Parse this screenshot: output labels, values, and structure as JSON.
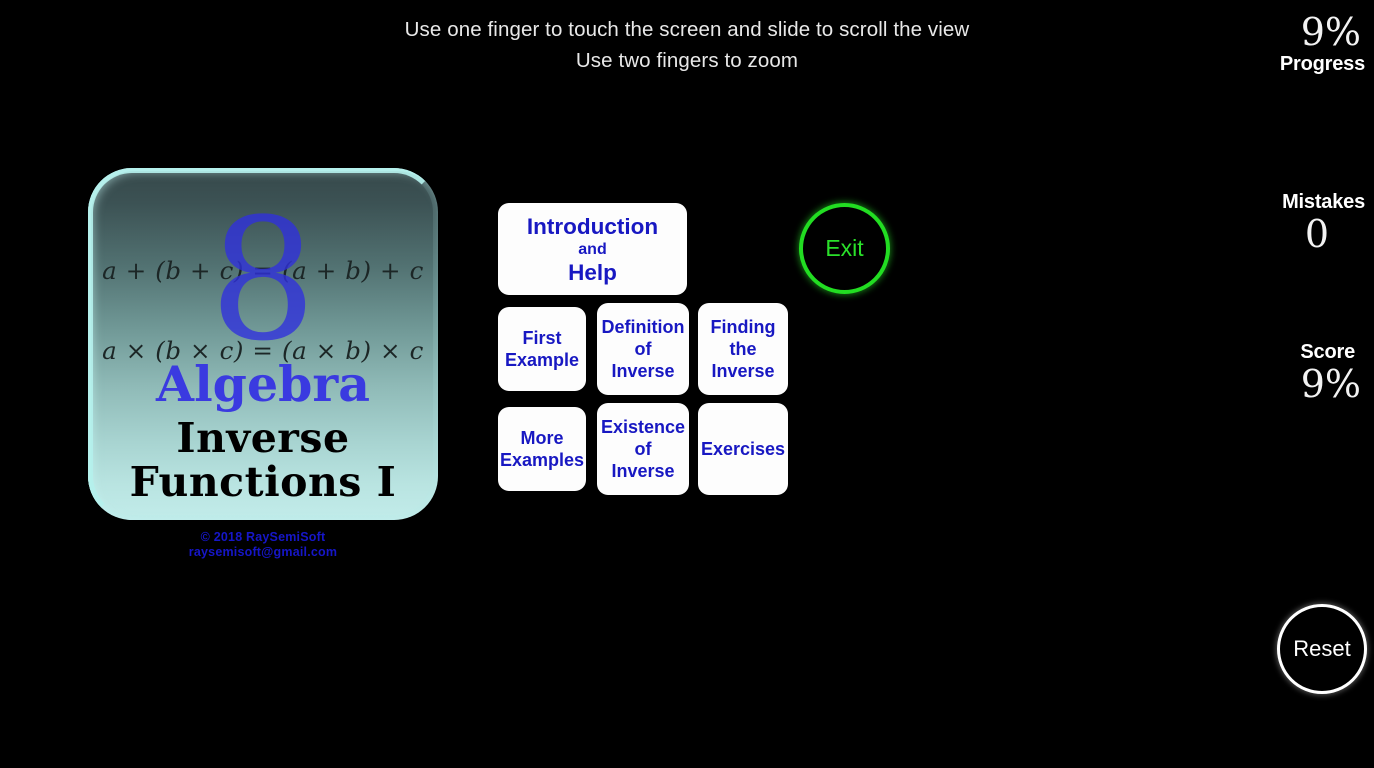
{
  "instructions": {
    "line1": "Use one finger to touch the screen and slide to scroll the view",
    "line2": "Use two fingers to zoom"
  },
  "stats": {
    "progress": {
      "label": "Progress",
      "value": "9%"
    },
    "mistakes": {
      "label": "Mistakes",
      "value": "0"
    },
    "score": {
      "label": "Score",
      "value": "9%"
    }
  },
  "title_card": {
    "badge_number": "8",
    "formula1": "a + (b + c) = (a + b) + c",
    "formula2": "a × (b × c) = (a × b) × c",
    "subject": "Algebra",
    "topic_line1": "Inverse",
    "topic_line2": "Functions I",
    "subject_color": "#3a3ae0",
    "badge_color": "#3030de",
    "border_color": "#b5f0ec"
  },
  "copyright": {
    "line1": "© 2018 RaySemiSoft",
    "line2": "raysemisoft@gmail.com",
    "color": "#1616c8"
  },
  "menu": {
    "intro": {
      "line1": "Introduction",
      "line2": "and",
      "line3": "Help"
    },
    "first": {
      "line1": "First",
      "line2": "Example"
    },
    "definition": {
      "line1": "Definition",
      "line2": "of",
      "line3": "Inverse"
    },
    "finding": {
      "line1": "Finding",
      "line2": "the",
      "line3": "Inverse"
    },
    "more": {
      "line1": "More",
      "line2": "Examples"
    },
    "existence": {
      "line1": "Existence",
      "line2": "of",
      "line3": "Inverse"
    },
    "exercises": {
      "line1": "Exercises"
    },
    "text_color": "#1818c2"
  },
  "actions": {
    "exit": {
      "label": "Exit",
      "color": "#22dd22"
    },
    "reset": {
      "label": "Reset",
      "color": "#ffffff"
    }
  }
}
